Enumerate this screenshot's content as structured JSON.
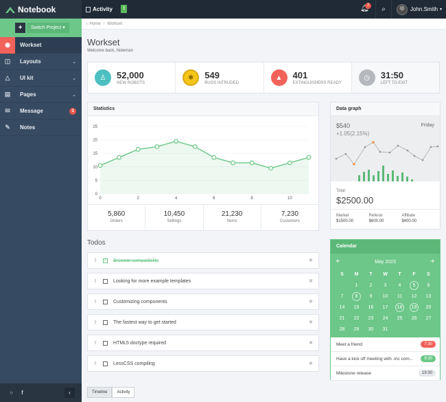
{
  "brand": {
    "name": "Notebook"
  },
  "topbar": {
    "activity_label": "Activity",
    "notifications_count": "2",
    "user_name": "John.Smith"
  },
  "sidebar": {
    "switch_label": "Switch Project",
    "items": [
      {
        "label": "Workset",
        "icon": "dashboard-icon"
      },
      {
        "label": "Layouts",
        "icon": "columns-icon"
      },
      {
        "label": "UI kit",
        "icon": "flask-icon"
      },
      {
        "label": "Pages",
        "icon": "file-icon"
      },
      {
        "label": "Message",
        "icon": "envelope-icon",
        "badge": "3"
      },
      {
        "label": "Notes",
        "icon": "pencil-icon"
      }
    ]
  },
  "breadcrumb": {
    "home": "Home",
    "current": "Workset"
  },
  "header": {
    "title": "Workset",
    "subtitle": "Welcome back, Noteman"
  },
  "stats": [
    {
      "value": "52,000",
      "label": "NEW ROBOTS",
      "color": "#4cc0c1",
      "icon": "male-icon"
    },
    {
      "value": "549",
      "label": "BUGS INTRUDED",
      "color": "#f5c518",
      "icon": "bug-icon"
    },
    {
      "value": "401",
      "label": "EXTINGUISHERS READY",
      "color": "#f0625a",
      "icon": "fire-extinguisher-icon"
    },
    {
      "value": "31:50",
      "label": "LEFT TO EXIT",
      "color": "#b5b9bd",
      "icon": "clock-icon"
    }
  ],
  "statistics": {
    "title": "Statistics",
    "footer": [
      {
        "value": "5,860",
        "label": "Orders"
      },
      {
        "value": "10,450",
        "label": "Sellings"
      },
      {
        "value": "21,230",
        "label": "Items"
      },
      {
        "value": "7,230",
        "label": "Customers"
      }
    ]
  },
  "chart_data": {
    "type": "line",
    "x": [
      0,
      1,
      2,
      3,
      4,
      5,
      6,
      7,
      8,
      9,
      10,
      11
    ],
    "values": [
      10.5,
      13.5,
      16.5,
      17.5,
      19.5,
      17.5,
      13.5,
      11.5,
      11.5,
      9.5,
      11.5,
      13.5
    ],
    "xticks": [
      "0",
      "2",
      "4",
      "6",
      "8",
      "10"
    ],
    "yticks": [
      "0",
      "5",
      "10",
      "15",
      "20",
      "25"
    ],
    "xlim": [
      0,
      11
    ],
    "ylim": [
      0,
      25
    ],
    "color": "#6cc788"
  },
  "datagraph": {
    "title": "Data graph",
    "value": "$540",
    "change": "+1.05(2.15%)",
    "day": "Friday",
    "total_label": "Total:",
    "total": "$2500.00",
    "footer": [
      {
        "label": "Market",
        "value": "$1500.00"
      },
      {
        "label": "Referal",
        "value": "$600.00"
      },
      {
        "label": "Affiliate",
        "value": "$400.00"
      }
    ]
  },
  "todos": {
    "title": "Todos",
    "items": [
      {
        "label": "Browser compatibility",
        "done": true
      },
      {
        "label": "Looking for more example templates",
        "done": false
      },
      {
        "label": "Customizing components",
        "done": false
      },
      {
        "label": "The fastest way to get started",
        "done": false
      },
      {
        "label": "HTML5 doctype required",
        "done": false
      },
      {
        "label": "LessCSS compiling",
        "done": false
      }
    ]
  },
  "tabs": {
    "timeline": "Timeline",
    "activity": "Activity"
  },
  "calendar": {
    "title": "Calendar",
    "month": "May 2023",
    "weekdays": [
      "S",
      "M",
      "T",
      "W",
      "T",
      "F",
      "S"
    ],
    "marked_days": [
      "5",
      "8",
      "18",
      "19"
    ],
    "days": [
      "",
      "1",
      "2",
      "3",
      "4",
      "5",
      "6",
      "7",
      "8",
      "9",
      "10",
      "11",
      "12",
      "13",
      "14",
      "15",
      "16",
      "17",
      "18",
      "19",
      "20",
      "21",
      "22",
      "23",
      "24",
      "25",
      "26",
      "27",
      "28",
      "29",
      "30",
      "31",
      "",
      "",
      ""
    ],
    "events": [
      {
        "label": "Meet a friend",
        "time": "7:30",
        "color": "#f0625a"
      },
      {
        "label": "Have a kick off meeting with .inc com...",
        "time": "9:30",
        "color": "#6cc788"
      },
      {
        "label": "Milestone release",
        "time": "19:30",
        "color": "#e6e9ec"
      }
    ]
  }
}
